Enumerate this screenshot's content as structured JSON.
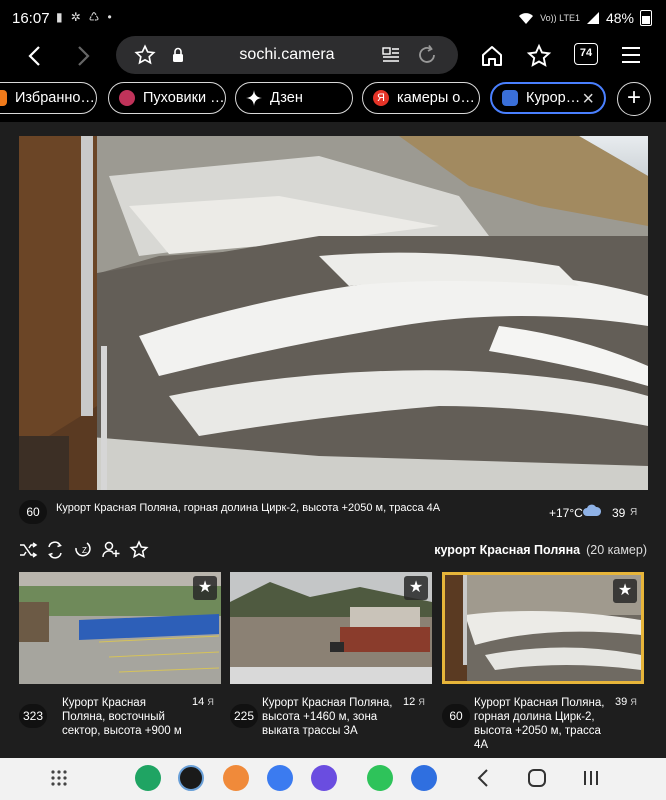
{
  "status_bar": {
    "time": "16:07",
    "network_label": "Vo)) LTE1",
    "battery": "48%",
    "icons": [
      "sim-icon",
      "fan-icon",
      "nearby-icon",
      "dot-icon",
      "wifi-icon",
      "signal-icon",
      "battery-icon"
    ]
  },
  "browser": {
    "url": "sochi.camera",
    "tab_count": "74",
    "tabs": [
      {
        "label": "Избранно…",
        "favicon_color": "#f07a1a"
      },
      {
        "label": "Пуховики …",
        "favicon_color": "#c0335a"
      },
      {
        "label": "Дзен",
        "favicon_color": "#000000"
      },
      {
        "label": "камеры о…",
        "favicon_color": "#e53327"
      },
      {
        "label": "Курор…",
        "favicon_color": "#3a6fd8"
      }
    ],
    "accent_color": "#4a80ff"
  },
  "main_camera": {
    "id_badge": "60",
    "title": "Курорт Красная Поляна, горная долина Цирк-2, высота +2050 м, трасса 4А",
    "temperature": "+17°C",
    "weather_icon": "cloud-icon",
    "viewers": "39",
    "viewers_icon": "person-icon"
  },
  "actions": [
    "shuffle-icon",
    "cycle-icon",
    "sleep-icon",
    "add-user-icon",
    "favorite-star-icon"
  ],
  "category": {
    "name": "курорт Красная Поляна",
    "count": "(20 камер)"
  },
  "cameras": [
    {
      "id_badge": "323",
      "title": "Курорт Красная Поляна, восточный сектор, высота +900 м",
      "viewers": "14"
    },
    {
      "id_badge": "225",
      "title": "Курорт Красная Поляна, высота +1460 м, зона выката трассы 3А",
      "viewers": "12"
    },
    {
      "id_badge": "60",
      "title": "Курорт Красная Поляна, горная долина Цирк-2, высота +2050 м, трасса 4А",
      "viewers": "39"
    }
  ],
  "selected_color": "#e7b53a",
  "nav_bar": {
    "apps": [
      "apps-grid-icon",
      "phone-icon",
      "bmw-icon",
      "contacts-icon",
      "messages-icon",
      "internet-icon",
      "whatsapp-icon",
      "browser-icon"
    ],
    "system": [
      "back-icon",
      "home-icon",
      "recents-icon"
    ]
  }
}
